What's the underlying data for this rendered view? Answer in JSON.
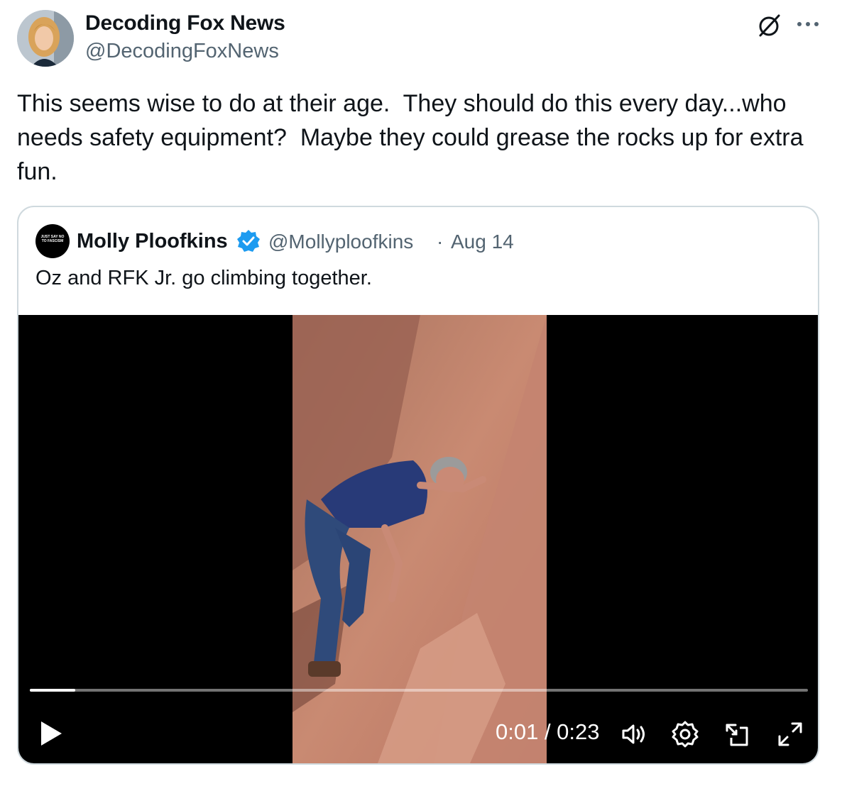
{
  "post": {
    "author_name": "Decoding Fox News",
    "author_handle": "@DecodingFoxNews",
    "text": "This seems wise to do at their age.  They should do this every day...who needs safety equipment?  Maybe they could grease the rocks up for extra fun.",
    "grok_icon": "grok-icon",
    "more_icon": "more-icon"
  },
  "quote": {
    "author_name": "Molly Ploofkins",
    "author_handle": "@Mollyploofkins",
    "separator": "·",
    "date": "Aug 14",
    "text": "Oz and RFK Jr. go climbing together.",
    "avatar_text": "JUST SAY NO TO FASCISM",
    "verified_color": "#1d9bf0"
  },
  "video": {
    "current_time": "0:01",
    "duration": "0:23",
    "time_label": "0:01 / 0:23",
    "progress_fraction": 0.058,
    "controls": [
      "play-icon",
      "volume-icon",
      "settings-icon",
      "pip-icon",
      "fullscreen-icon"
    ]
  }
}
